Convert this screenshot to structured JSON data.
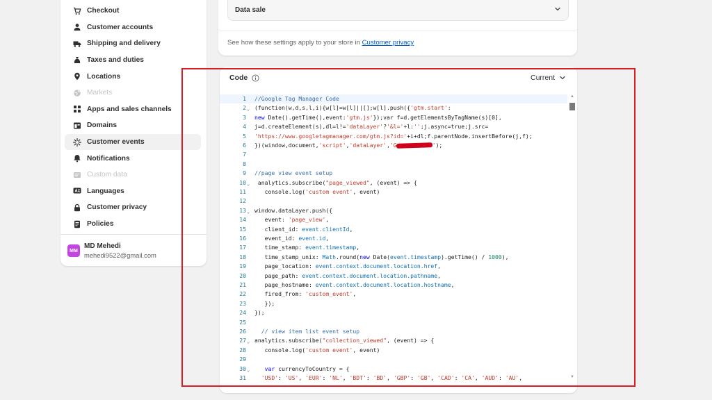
{
  "sidebar": {
    "items": [
      {
        "label": "Checkout",
        "icon": "cart-icon",
        "state": "normal"
      },
      {
        "label": "Customer accounts",
        "icon": "person-icon",
        "state": "normal"
      },
      {
        "label": "Shipping and delivery",
        "icon": "truck-icon",
        "state": "normal"
      },
      {
        "label": "Taxes and duties",
        "icon": "money-bag-icon",
        "state": "normal"
      },
      {
        "label": "Locations",
        "icon": "location-pin-icon",
        "state": "normal"
      },
      {
        "label": "Markets",
        "icon": "globe-icon",
        "state": "disabled"
      },
      {
        "label": "Apps and sales channels",
        "icon": "apps-grid-icon",
        "state": "normal"
      },
      {
        "label": "Domains",
        "icon": "domain-window-icon",
        "state": "normal"
      },
      {
        "label": "Customer events",
        "icon": "sparkle-events-icon",
        "state": "active"
      },
      {
        "label": "Notifications",
        "icon": "bell-icon",
        "state": "normal"
      },
      {
        "label": "Custom data",
        "icon": "custom-data-icon",
        "state": "disabled"
      },
      {
        "label": "Languages",
        "icon": "language-icon",
        "state": "normal"
      },
      {
        "label": "Customer privacy",
        "icon": "lock-icon",
        "state": "normal"
      },
      {
        "label": "Policies",
        "icon": "policy-document-icon",
        "state": "normal"
      }
    ],
    "user": {
      "initials": "MM",
      "name": "MD Mehedi",
      "email": "mehedi9522@gmail.com",
      "avatar_color": "#c246e0"
    }
  },
  "top_card": {
    "accordion_label": "Data sale",
    "note_prefix": "See how these settings apply to your store in ",
    "note_link": "Customer privacy"
  },
  "code_card": {
    "title": "Code",
    "version": "Current",
    "current_line": 1,
    "lines": [
      {
        "n": 1,
        "fold": false,
        "tokens": [
          [
            "cm",
            "//Google Tag Manager Code"
          ]
        ]
      },
      {
        "n": 2,
        "fold": true,
        "tokens": [
          [
            "t",
            "(function(w,d,s,l,i){w[l]=w[l]||[];w[l].push({"
          ],
          [
            "str",
            "'gtm.start'"
          ],
          [
            "t",
            ":"
          ]
        ]
      },
      {
        "n": 3,
        "fold": false,
        "tokens": [
          [
            "kw",
            "new"
          ],
          [
            "t",
            " Date().getTime(),event:"
          ],
          [
            "str",
            "'gtm.js'"
          ],
          [
            "t",
            "});var f=d.getElementsByTagName(s)[0],"
          ]
        ]
      },
      {
        "n": 4,
        "fold": false,
        "tokens": [
          [
            "t",
            "j=d.createElement(s),dl=l!="
          ],
          [
            "str",
            "'dataLayer'"
          ],
          [
            "t",
            "?"
          ],
          [
            "str",
            "'&l='"
          ],
          [
            "t",
            "+l:"
          ],
          [
            "str",
            "''"
          ],
          [
            "t",
            ";j.async=true;j.src="
          ]
        ]
      },
      {
        "n": 5,
        "fold": false,
        "tokens": [
          [
            "str",
            "'https://www.googletagmanager.com/gtm.js?id='"
          ],
          [
            "t",
            "+i+dl;f.parentNode.insertBefore(j,f);"
          ]
        ]
      },
      {
        "n": 6,
        "fold": false,
        "tokens": [
          [
            "t",
            "})(window,document,"
          ],
          [
            "str",
            "'script'"
          ],
          [
            "t",
            ","
          ],
          [
            "str",
            "'dataLayer'"
          ],
          [
            "t",
            ","
          ],
          [
            "str",
            "'G"
          ],
          [
            "redact",
            ""
          ],
          [
            "str",
            "'"
          ],
          [
            "t",
            ");"
          ]
        ]
      },
      {
        "n": 7,
        "fold": false,
        "tokens": []
      },
      {
        "n": 8,
        "fold": false,
        "tokens": []
      },
      {
        "n": 9,
        "fold": false,
        "tokens": [
          [
            "cm",
            "//page view event setup"
          ]
        ]
      },
      {
        "n": 10,
        "fold": true,
        "tokens": [
          [
            "t",
            " analytics.subscribe("
          ],
          [
            "str",
            "\"page_viewed\""
          ],
          [
            "t",
            ", (event) => {"
          ]
        ]
      },
      {
        "n": 11,
        "fold": false,
        "tokens": [
          [
            "t",
            "   console.log("
          ],
          [
            "str",
            "'custom event'"
          ],
          [
            "t",
            ", event)"
          ]
        ]
      },
      {
        "n": 12,
        "fold": false,
        "tokens": []
      },
      {
        "n": 13,
        "fold": true,
        "tokens": [
          [
            "t",
            "window.dataLayer.push({"
          ]
        ]
      },
      {
        "n": 14,
        "fold": false,
        "tokens": [
          [
            "t",
            "   event: "
          ],
          [
            "str",
            "'page_view'"
          ],
          [
            "t",
            ","
          ]
        ]
      },
      {
        "n": 15,
        "fold": false,
        "tokens": [
          [
            "t",
            "   client_id: "
          ],
          [
            "prop",
            "event.clientId"
          ],
          [
            "t",
            ","
          ]
        ]
      },
      {
        "n": 16,
        "fold": false,
        "tokens": [
          [
            "t",
            "   event_id: "
          ],
          [
            "prop",
            "event.id"
          ],
          [
            "t",
            ","
          ]
        ]
      },
      {
        "n": 17,
        "fold": false,
        "tokens": [
          [
            "t",
            "   time_stamp: "
          ],
          [
            "prop",
            "event.timestamp"
          ],
          [
            "t",
            ","
          ]
        ]
      },
      {
        "n": 18,
        "fold": false,
        "tokens": [
          [
            "t",
            "   time_stamp_unix: "
          ],
          [
            "prop",
            "Math"
          ],
          [
            "t",
            ".round("
          ],
          [
            "kw",
            "new"
          ],
          [
            "t",
            " Date("
          ],
          [
            "prop",
            "event.timestamp"
          ],
          [
            "t",
            ").getTime() / "
          ],
          [
            "num",
            "1000"
          ],
          [
            "t",
            "),"
          ]
        ]
      },
      {
        "n": 19,
        "fold": false,
        "tokens": [
          [
            "t",
            "   page_location: "
          ],
          [
            "prop",
            "event.context.document.location.href"
          ],
          [
            "t",
            ","
          ]
        ]
      },
      {
        "n": 20,
        "fold": false,
        "tokens": [
          [
            "t",
            "   page_path: "
          ],
          [
            "prop",
            "event.context.document.location.pathname"
          ],
          [
            "t",
            ","
          ]
        ]
      },
      {
        "n": 21,
        "fold": false,
        "tokens": [
          [
            "t",
            "   page_hostname: "
          ],
          [
            "prop",
            "event.context.document.location.hostname"
          ],
          [
            "t",
            ","
          ]
        ]
      },
      {
        "n": 22,
        "fold": false,
        "tokens": [
          [
            "t",
            "   fired_from: "
          ],
          [
            "str",
            "'custom_event'"
          ],
          [
            "t",
            ","
          ]
        ]
      },
      {
        "n": 23,
        "fold": false,
        "tokens": [
          [
            "t",
            "   });"
          ]
        ]
      },
      {
        "n": 24,
        "fold": false,
        "tokens": [
          [
            "t",
            "});"
          ]
        ]
      },
      {
        "n": 25,
        "fold": false,
        "tokens": []
      },
      {
        "n": 26,
        "fold": false,
        "tokens": [
          [
            "cm",
            "  // view item list event setup"
          ]
        ]
      },
      {
        "n": 27,
        "fold": true,
        "tokens": [
          [
            "t",
            "analytics.subscribe("
          ],
          [
            "str",
            "\"collection_viewed\""
          ],
          [
            "t",
            ", (event) => {"
          ]
        ]
      },
      {
        "n": 28,
        "fold": false,
        "tokens": [
          [
            "t",
            "   console.log("
          ],
          [
            "str",
            "'custom event'"
          ],
          [
            "t",
            ", event)"
          ]
        ]
      },
      {
        "n": 29,
        "fold": false,
        "tokens": []
      },
      {
        "n": 30,
        "fold": true,
        "tokens": [
          [
            "t",
            "   "
          ],
          [
            "kw",
            "var"
          ],
          [
            "t",
            " currencyToCountry = {"
          ]
        ]
      },
      {
        "n": 31,
        "fold": false,
        "tokens": [
          [
            "t",
            "  "
          ],
          [
            "str",
            "'USD'"
          ],
          [
            "t",
            ": "
          ],
          [
            "str",
            "'US'"
          ],
          [
            "t",
            ", "
          ],
          [
            "str",
            "'EUR'"
          ],
          [
            "t",
            ": "
          ],
          [
            "str",
            "'NL'"
          ],
          [
            "t",
            ", "
          ],
          [
            "str",
            "'BDT'"
          ],
          [
            "t",
            ": "
          ],
          [
            "str",
            "'BD'"
          ],
          [
            "t",
            ", "
          ],
          [
            "str",
            "'GBP'"
          ],
          [
            "t",
            ": "
          ],
          [
            "str",
            "'GB'"
          ],
          [
            "t",
            ", "
          ],
          [
            "str",
            "'CAD'"
          ],
          [
            "t",
            ": "
          ],
          [
            "str",
            "'CA'"
          ],
          [
            "t",
            ", "
          ],
          [
            "str",
            "'AUD'"
          ],
          [
            "t",
            ": "
          ],
          [
            "str",
            "'AU'"
          ],
          [
            "t",
            ","
          ]
        ]
      }
    ]
  },
  "colors": {
    "accent_link": "#005bd3",
    "highlight_border": "#e01b24",
    "active_item_bg": "#f1f1f1"
  }
}
